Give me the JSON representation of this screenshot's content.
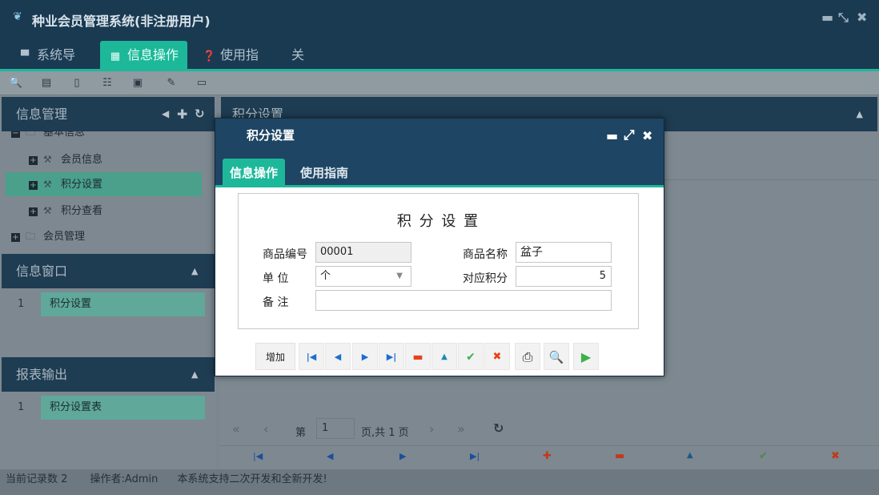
{
  "app": {
    "title": "种业会员管理系统(非注册用户)",
    "logo_icon": "seed-logo-icon",
    "window_controls": [
      "minimize-icon",
      "restore-icon",
      "close-icon"
    ]
  },
  "menubar": {
    "tabs": [
      {
        "label": "系统导航",
        "icon": "monitor-icon",
        "active": false
      },
      {
        "label": "信息操作",
        "icon": "grid-icon",
        "active": true
      },
      {
        "label": "使用指南",
        "icon": "help-icon",
        "active": false
      },
      {
        "label": "关于",
        "icon": "",
        "active": false
      }
    ]
  },
  "toolbar": {
    "icons": [
      "search-doc-icon",
      "list-icon",
      "page-icon",
      "users-icon",
      "report-icon",
      "edit-icon",
      "window-icon"
    ]
  },
  "left": {
    "info_mgmt": {
      "title": "信息管理",
      "tree": [
        {
          "label": "基本信息",
          "type": "folder",
          "open": true
        },
        {
          "label": "会员信息",
          "type": "leaf",
          "selected": false
        },
        {
          "label": "积分设置",
          "type": "leaf",
          "selected": true
        },
        {
          "label": "积分查看",
          "type": "leaf",
          "selected": false
        },
        {
          "label": "会员管理",
          "type": "folder",
          "open": false
        }
      ]
    },
    "info_window": {
      "title": "信息窗口",
      "rows": [
        {
          "no": "1",
          "label": "积分设置"
        }
      ]
    },
    "report": {
      "title": "报表输出",
      "rows": [
        {
          "no": "1",
          "label": "积分设置表"
        }
      ]
    }
  },
  "right": {
    "title": "积分设置",
    "pager": {
      "page_prefix": "第",
      "page_value": "1",
      "page_suffix": "页,共 1 页"
    }
  },
  "dialog": {
    "title": "积分设置",
    "tabs": [
      {
        "label": "信息操作",
        "active": true
      },
      {
        "label": "使用指南",
        "active": false
      }
    ],
    "form": {
      "heading": "积 分 设 置",
      "code_label": "商品编号",
      "code_value": "00001",
      "name_label": "商品名称",
      "name_value": "盆子",
      "unit_label": "单 位",
      "unit_value": "个",
      "points_label": "对应积分",
      "points_value": "5",
      "remark_label": "备 注",
      "remark_value": ""
    },
    "buttons": {
      "add_label": "增加"
    }
  },
  "status": {
    "record_count": "当前记录数 2",
    "operator": "操作者:Admin",
    "note": "本系统支持二次开发和全新开发!"
  },
  "colors": {
    "header_dark": "#1a3a52",
    "accent": "#1db89a",
    "nav_blue": "#1a6fd1",
    "delete_red": "#e8421a",
    "ok_green": "#3cb04a"
  }
}
